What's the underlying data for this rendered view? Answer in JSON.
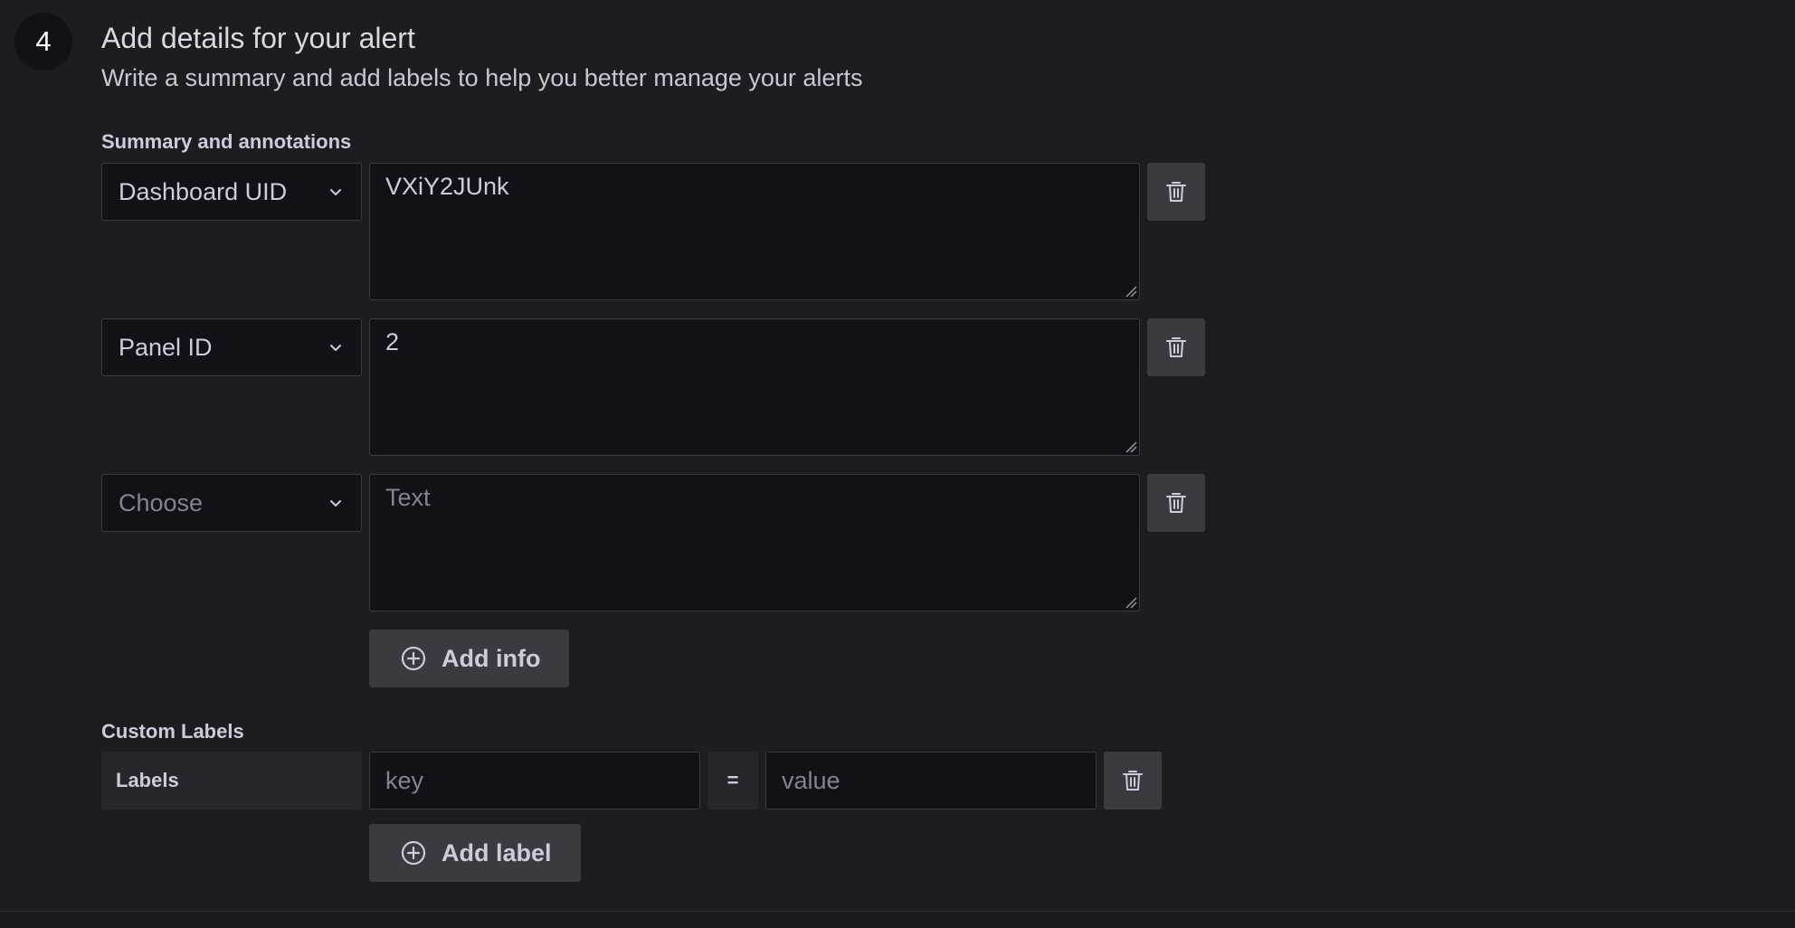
{
  "step": {
    "number": "4",
    "title": "Add details for your alert",
    "description": "Write a summary and add labels to help you better manage your alerts"
  },
  "annotations": {
    "section_label": "Summary and annotations",
    "rows": [
      {
        "key": "Dashboard UID",
        "value": "VXiY2JUnk"
      },
      {
        "key": "Panel ID",
        "value": "2"
      },
      {
        "key_placeholder": "Choose",
        "value_placeholder": "Text"
      }
    ],
    "add_button_label": "Add info"
  },
  "custom_labels": {
    "section_label": "Custom Labels",
    "tag": "Labels",
    "key_placeholder": "key",
    "operator": "=",
    "value_placeholder": "value",
    "add_button_label": "Add label"
  },
  "icons": {
    "delete": "trash-icon",
    "dropdown": "chevron-down-icon",
    "add": "plus-circle-icon"
  },
  "colors": {
    "background": "#1c1d21",
    "input_background": "#111217",
    "button_background": "#3a3b40"
  }
}
